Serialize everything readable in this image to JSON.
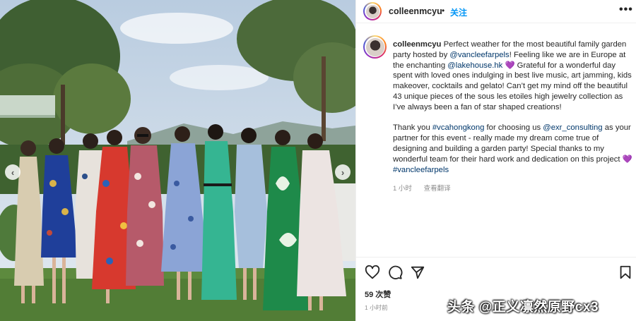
{
  "post": {
    "username": "colleenmcyu",
    "dot": "•",
    "follow_label": "关注",
    "more_label": "•••",
    "caption": {
      "username": "colleenmcyu",
      "p1_a": " Perfect weather for the most beautiful family garden party hosted by ",
      "mention1": "@vancleefarpels",
      "p1_b": "! Feeling like we are in Europe at the enchanting ",
      "mention2": "@lakehouse.hk",
      "heart1": "💜",
      "p1_c": " Grateful for a wonderful day spent with loved ones indulging in best live music, art jamming, kids makeover, cocktails and gelato! Can’t get my mind off the beautiful 43 unique pieces of the sous les etoiles high jewelry collection as I’ve always been a fan of star shaped creations!",
      "p2_a": "Thank you ",
      "hashtag1": "#vcahongkong",
      "p2_b": " for choosing us ",
      "mention3": "@exr_consulting",
      "p2_c": " as your partner for this event - really made my dream come true of designing and building a garden party! Special thanks to my wonderful team for their hard work and dedication on this project ",
      "heart2": "💜",
      "hashtag2": "#vancleefarpels"
    },
    "time_short": "1 小时",
    "see_translation": "查看翻译",
    "likes": "59 次赞",
    "time_ago": "1 小时前"
  },
  "photo": {
    "prev_label": "‹",
    "next_label": "›"
  },
  "watermark": "头条 @正义凛然原野cx3",
  "icons": [
    "heart-icon",
    "comment-icon",
    "share-icon",
    "bookmark-icon",
    "more-icon"
  ],
  "colors": {
    "link": "#00376b",
    "follow": "#0095f6",
    "secondary_text": "#8e8e8e",
    "heart_emoji": "#8a4fd6"
  }
}
